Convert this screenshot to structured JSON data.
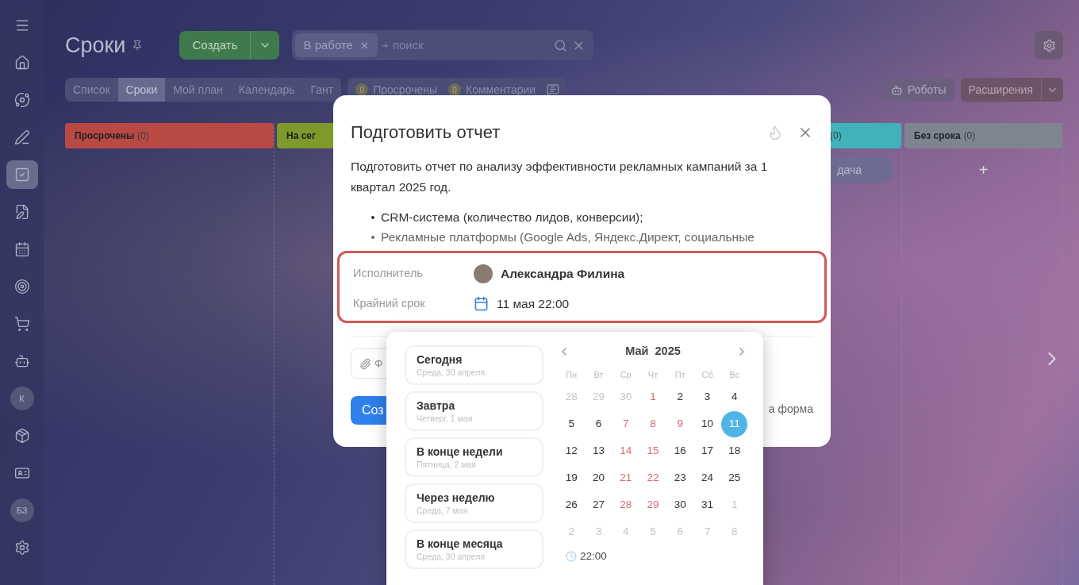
{
  "sidebar": {
    "items": [
      {
        "kind": "icon",
        "selected": false
      },
      {
        "kind": "icon",
        "selected": false
      },
      {
        "kind": "icon",
        "selected": false
      },
      {
        "kind": "icon",
        "selected": false
      },
      {
        "kind": "icon",
        "selected": true
      },
      {
        "kind": "icon",
        "selected": false
      },
      {
        "kind": "icon",
        "selected": false
      },
      {
        "kind": "icon",
        "selected": false
      },
      {
        "kind": "icon",
        "selected": false
      },
      {
        "kind": "icon",
        "selected": false
      },
      {
        "kind": "avatar",
        "label": "К",
        "selected": false
      },
      {
        "kind": "icon",
        "selected": false
      },
      {
        "kind": "icon",
        "selected": false
      },
      {
        "kind": "avatar",
        "label": "БЗ",
        "selected": false
      },
      {
        "kind": "icon",
        "selected": false
      }
    ]
  },
  "header": {
    "title": "Сроки",
    "create_button": "Создать",
    "filter_chip": "В работе",
    "search": {
      "placeholder": "+ поиск"
    }
  },
  "view_tabs": [
    {
      "label": "Список",
      "selected": false
    },
    {
      "label": "Сроки",
      "selected": true
    },
    {
      "label": "Мой план",
      "selected": false
    },
    {
      "label": "Календарь",
      "selected": false
    },
    {
      "label": "Гант",
      "selected": false
    }
  ],
  "counters": [
    {
      "count": "0",
      "label": "Просрочены"
    },
    {
      "count": "0",
      "label": "Комментарии"
    }
  ],
  "toolbar": {
    "robots": "Роботы",
    "extensions": "Расширения"
  },
  "columns": [
    {
      "title": "Просрочены",
      "count": "(0)",
      "color": "#b84a43"
    },
    {
      "title": "На сег",
      "color": "#7d9a2a"
    },
    {
      "count": "(0)",
      "color": "#3fb3b9",
      "add_task": "дача"
    },
    {
      "title": "Без срока",
      "count": "(0)",
      "color": "#7f8590",
      "add": "+"
    }
  ],
  "task_dialog": {
    "title": "Подготовить отчет",
    "description": "Подготовить отчет по анализу эффективности рекламных кампаний за 1 квартал 2025 год.",
    "bullets": [
      "CRM-система (количество лидов, конверсии);",
      "Рекламные платформы (Google Ads, Яндекс.Директ, социальные"
    ],
    "assignee": {
      "label": "Исполнитель",
      "value": "Александра Филина"
    },
    "deadline": {
      "label": "Крайний срок",
      "value": "11 мая 22:00"
    },
    "files_field": "Ф",
    "create_button": "Соз",
    "form_link": "а форма"
  },
  "date_picker": {
    "presets": [
      {
        "label": "Сегодня",
        "date": "Среда, 30 апреля"
      },
      {
        "label": "Завтра",
        "date": "Четверг, 1 мая"
      },
      {
        "label": "В конце недели",
        "date": "Пятница, 2 мая"
      },
      {
        "label": "Через неделю",
        "date": "Среда, 7 мая"
      },
      {
        "label": "В конце месяца",
        "date": "Среда, 30 апреля"
      }
    ],
    "month": "Май  2025",
    "weekdays": [
      "Пн",
      "Вт",
      "Ср",
      "Чт",
      "Пт",
      "Сб",
      "Вс"
    ],
    "weeks": [
      [
        {
          "d": "28",
          "kind": "other",
          "selected": false
        },
        {
          "d": "29",
          "kind": "other",
          "selected": false
        },
        {
          "d": "30",
          "kind": "other",
          "selected": false
        },
        {
          "d": "1",
          "kind": "holiday",
          "selected": false
        },
        {
          "d": "2",
          "kind": "day",
          "selected": false
        },
        {
          "d": "3",
          "kind": "day",
          "selected": false
        },
        {
          "d": "4",
          "kind": "day",
          "selected": false
        }
      ],
      [
        {
          "d": "5",
          "kind": "day",
          "selected": false
        },
        {
          "d": "6",
          "kind": "day",
          "selected": false
        },
        {
          "d": "7",
          "kind": "holiday",
          "selected": false
        },
        {
          "d": "8",
          "kind": "holiday",
          "selected": false
        },
        {
          "d": "9",
          "kind": "holiday",
          "selected": false
        },
        {
          "d": "10",
          "kind": "day",
          "selected": false
        },
        {
          "d": "11",
          "kind": "day",
          "selected": true
        }
      ],
      [
        {
          "d": "12",
          "kind": "day",
          "selected": false
        },
        {
          "d": "13",
          "kind": "day",
          "selected": false
        },
        {
          "d": "14",
          "kind": "holiday",
          "selected": false
        },
        {
          "d": "15",
          "kind": "holiday",
          "selected": false
        },
        {
          "d": "16",
          "kind": "day",
          "selected": false
        },
        {
          "d": "17",
          "kind": "day",
          "selected": false
        },
        {
          "d": "18",
          "kind": "day",
          "selected": false
        }
      ],
      [
        {
          "d": "19",
          "kind": "day",
          "selected": false
        },
        {
          "d": "20",
          "kind": "day",
          "selected": false
        },
        {
          "d": "21",
          "kind": "holiday",
          "selected": false
        },
        {
          "d": "22",
          "kind": "holiday",
          "selected": false
        },
        {
          "d": "23",
          "kind": "day",
          "selected": false
        },
        {
          "d": "24",
          "kind": "day",
          "selected": false
        },
        {
          "d": "25",
          "kind": "day",
          "selected": false
        }
      ],
      [
        {
          "d": "26",
          "kind": "day",
          "selected": false
        },
        {
          "d": "27",
          "kind": "day",
          "selected": false
        },
        {
          "d": "28",
          "kind": "holiday",
          "selected": false
        },
        {
          "d": "29",
          "kind": "holiday",
          "selected": false
        },
        {
          "d": "30",
          "kind": "day",
          "selected": false
        },
        {
          "d": "31",
          "kind": "day",
          "selected": false
        },
        {
          "d": "1",
          "kind": "other",
          "selected": false
        }
      ],
      [
        {
          "d": "2",
          "kind": "other",
          "selected": false
        },
        {
          "d": "3",
          "kind": "other",
          "selected": false
        },
        {
          "d": "4",
          "kind": "other",
          "selected": false
        },
        {
          "d": "5",
          "kind": "other",
          "selected": false
        },
        {
          "d": "6",
          "kind": "other",
          "selected": false
        },
        {
          "d": "7",
          "kind": "other",
          "selected": false
        },
        {
          "d": "8",
          "kind": "other",
          "selected": false
        }
      ]
    ],
    "time": "22:00"
  }
}
